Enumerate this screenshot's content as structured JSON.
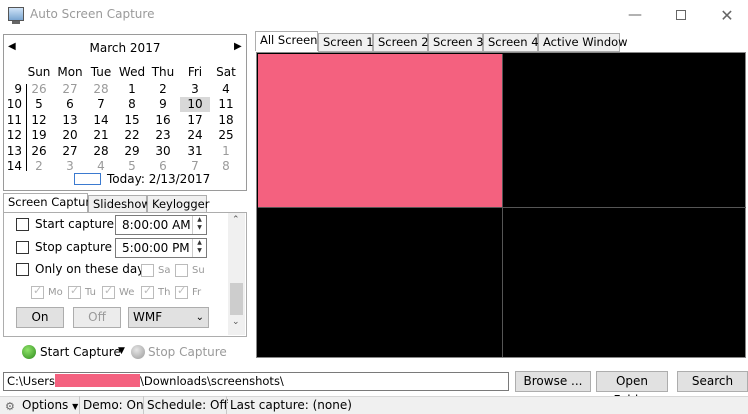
{
  "window": {
    "title": "Auto Screen Capture"
  },
  "calendar": {
    "month_label": "March 2017",
    "days_of_week": [
      "Sun",
      "Mon",
      "Tue",
      "Wed",
      "Thu",
      "Fri",
      "Sat"
    ],
    "weeks": [
      {
        "num": "9",
        "days": [
          {
            "d": "26",
            "other": true
          },
          {
            "d": "27",
            "other": true
          },
          {
            "d": "28",
            "other": true
          },
          {
            "d": "1"
          },
          {
            "d": "2"
          },
          {
            "d": "3"
          },
          {
            "d": "4"
          }
        ]
      },
      {
        "num": "10",
        "days": [
          {
            "d": "5"
          },
          {
            "d": "6"
          },
          {
            "d": "7"
          },
          {
            "d": "8"
          },
          {
            "d": "9"
          },
          {
            "d": "10",
            "selected": true
          },
          {
            "d": "11"
          }
        ]
      },
      {
        "num": "11",
        "days": [
          {
            "d": "12"
          },
          {
            "d": "13"
          },
          {
            "d": "14"
          },
          {
            "d": "15"
          },
          {
            "d": "16"
          },
          {
            "d": "17"
          },
          {
            "d": "18"
          }
        ]
      },
      {
        "num": "12",
        "days": [
          {
            "d": "19"
          },
          {
            "d": "20"
          },
          {
            "d": "21"
          },
          {
            "d": "22"
          },
          {
            "d": "23"
          },
          {
            "d": "24"
          },
          {
            "d": "25"
          }
        ]
      },
      {
        "num": "13",
        "days": [
          {
            "d": "26"
          },
          {
            "d": "27"
          },
          {
            "d": "28"
          },
          {
            "d": "29"
          },
          {
            "d": "30"
          },
          {
            "d": "31"
          },
          {
            "d": "1",
            "other": true
          }
        ]
      },
      {
        "num": "14",
        "days": [
          {
            "d": "2",
            "other": true
          },
          {
            "d": "3",
            "other": true
          },
          {
            "d": "4",
            "other": true
          },
          {
            "d": "5",
            "other": true
          },
          {
            "d": "6",
            "other": true
          },
          {
            "d": "7",
            "other": true
          },
          {
            "d": "8",
            "other": true
          }
        ]
      }
    ],
    "today_label": "Today: 2/13/2017"
  },
  "left_tabs": [
    "Screen Capture",
    "Slideshow",
    "Keylogger"
  ],
  "capture": {
    "start_label": "Start capture at",
    "start_time": "8:00:00 AM",
    "stop_label": "Stop capture at",
    "stop_time": "5:00:00 PM",
    "days_label": "Only on these days:",
    "days_top": [
      "Sa",
      "Su"
    ],
    "days_bottom": [
      "Mo",
      "Tu",
      "We",
      "Th",
      "Fr"
    ],
    "on_label": "On",
    "off_label": "Off",
    "format_value": "WMF"
  },
  "actions": {
    "start_label": "Start Capture",
    "stop_label": "Stop Capture"
  },
  "screen_tabs": [
    "All Screens",
    "Screen 1",
    "Screen 2",
    "Screen 3",
    "Screen 4",
    "Active Window"
  ],
  "path": {
    "prefix": "C:\\Users",
    "suffix": "\\Downloads\\screenshots\\"
  },
  "buttons": {
    "browse": "Browse ...",
    "open_folder": "Open Folder",
    "search": "Search"
  },
  "status": {
    "options": "Options",
    "demo": "Demo: On",
    "schedule": "Schedule: Off",
    "last_capture": "Last capture: (none)"
  },
  "colors": {
    "preview_highlight": "#f4617f",
    "preview_background": "#000000"
  }
}
